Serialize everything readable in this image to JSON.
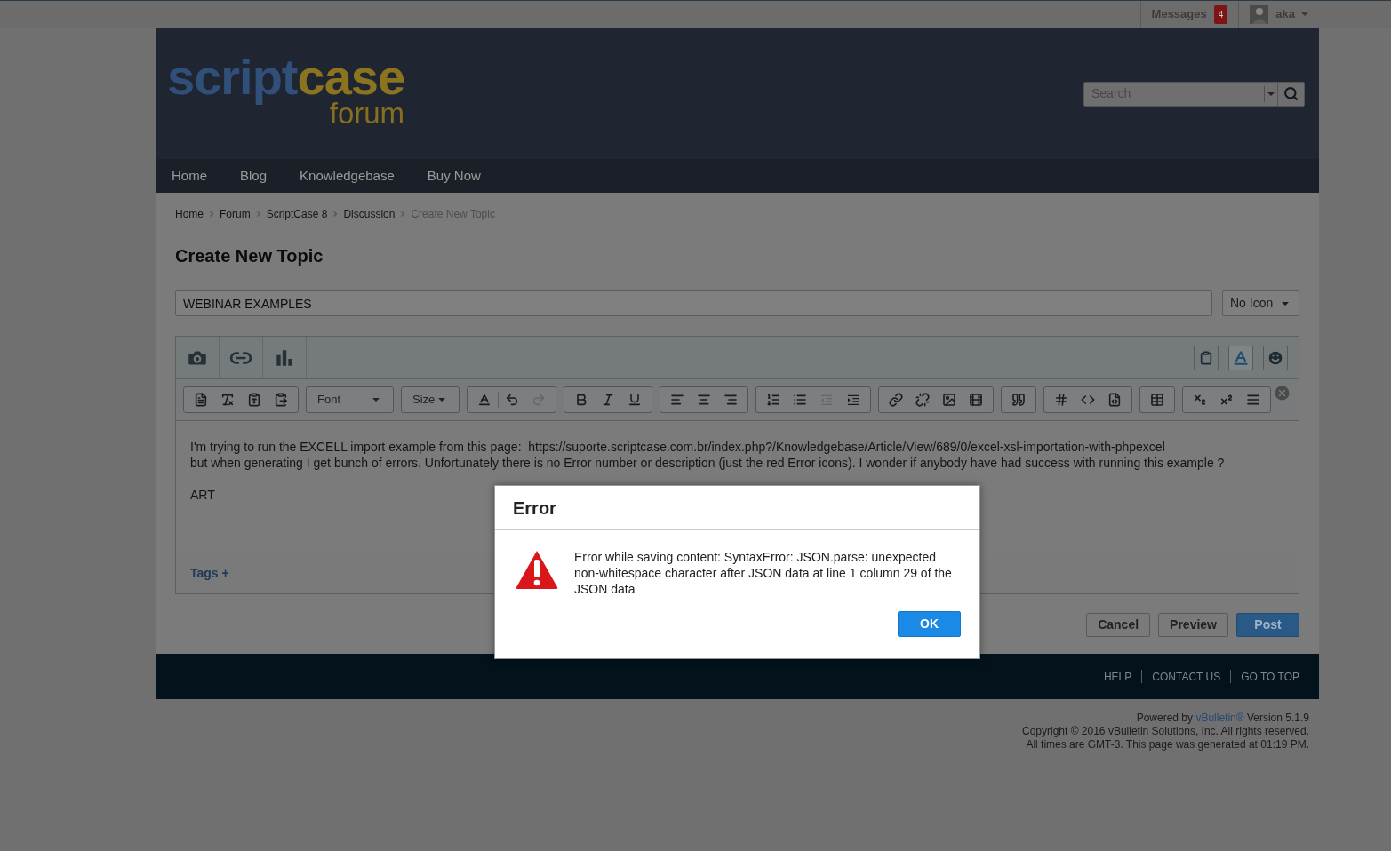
{
  "top_bar": {
    "messages": {
      "label": "Messages",
      "count": "4"
    },
    "user": {
      "name": "aka"
    }
  },
  "logo": {
    "part1": "script",
    "part2": "case",
    "sub": "forum"
  },
  "search": {
    "placeholder": "Search"
  },
  "nav": [
    {
      "label": "Home"
    },
    {
      "label": "Blog"
    },
    {
      "label": "Knowledgebase"
    },
    {
      "label": "Buy Now"
    }
  ],
  "breadcrumb": [
    {
      "label": "Home",
      "selected": false
    },
    {
      "label": "Forum",
      "selected": false
    },
    {
      "label": "ScriptCase 8",
      "selected": false
    },
    {
      "label": "Discussion",
      "selected": false
    },
    {
      "label": "Create New Topic",
      "selected": true
    }
  ],
  "page_title": "Create New Topic",
  "topic_title": {
    "value": "WEBINAR EXAMPLES"
  },
  "icon_select": {
    "value": "No Icon"
  },
  "editor": {
    "text_color_toggle_on": true,
    "font_label": "Font",
    "size_label": "Size",
    "paragraphs": [
      {
        "lines": [
          "I'm trying to run the EXCELL import example from this page:  https://suporte.scriptcase.com.br/index.php?/Knowledgebase/Article/View/689/0/excel-xsl-importation-with-phpexcel",
          "but when generating I get bunch of errors. Unfortunately there is no Error number or description (just the red Error icons). I wonder if anybody have had success with running this example ?"
        ]
      },
      {
        "lines": [
          "ART"
        ]
      }
    ],
    "tags_label": "Tags +"
  },
  "buttons": [
    {
      "label": "Cancel",
      "kind": "plain"
    },
    {
      "label": "Preview",
      "kind": "plain"
    },
    {
      "label": "Post",
      "kind": "primary"
    }
  ],
  "footer_links": [
    {
      "label": "HELP"
    },
    {
      "label": "CONTACT US"
    },
    {
      "label": "GO TO TOP"
    }
  ],
  "credits": {
    "powered_prefix": "Powered by",
    "powered_link": "vBulletin®",
    "powered_suffix": "Version 5.1.9",
    "copyright": "Copyright © 2016 vBulletin Solutions, Inc. All rights reserved.",
    "times": "All times are GMT-3. This page was generated at 01:19 PM."
  },
  "dialog": {
    "title": "Error",
    "message": "Error while saving content: SyntaxError: JSON.parse: unexpected non-whitespace character after JSON data at line 1 column 29 of the JSON data",
    "ok": "OK"
  }
}
